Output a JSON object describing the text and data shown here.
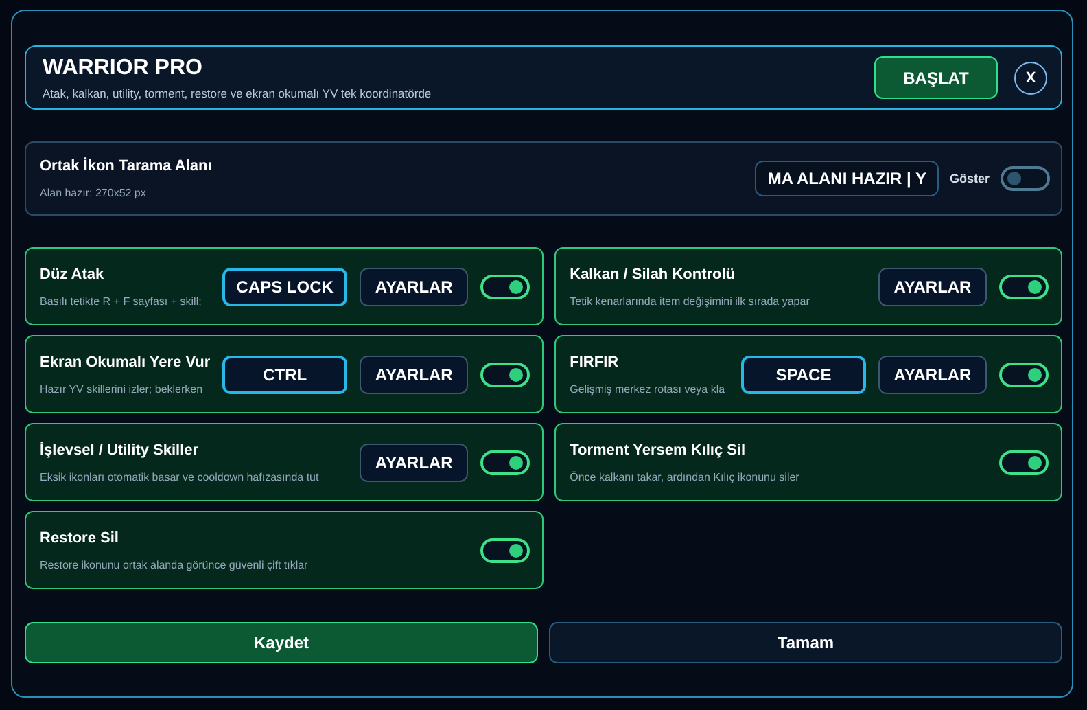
{
  "header": {
    "title": "WARRIOR PRO",
    "subtitle": "Atak, kalkan, utility, torment, restore ve ekran okumalı YV tek koordinatörde",
    "start_button": "BAŞLAT",
    "close_button": "X"
  },
  "scan_area": {
    "title": "Ortak İkon Tarama Alanı",
    "status": "Alan hazır: 270x52 px",
    "field_value": "MA ALANI HAZIR | Y",
    "show_label": "Göster",
    "show_on": false
  },
  "modules": [
    {
      "title": "Düz Atak",
      "description": "Basılı tetikte R + F sayfası + skill;",
      "key": "CAPS LOCK",
      "settings": "AYARLAR",
      "on": true
    },
    {
      "title": "Kalkan / Silah Kontrolü",
      "description": "Tetik kenarlarında item değişimini ilk sırada yapar",
      "settings": "AYARLAR",
      "on": true
    },
    {
      "title": "Ekran Okumalı Yere Vur",
      "description": "Hazır YV skillerini izler; beklerken",
      "key": "CTRL",
      "settings": "AYARLAR",
      "on": true
    },
    {
      "title": "FIRFIR",
      "description": "Gelişmiş merkez rotası veya kla",
      "key": "SPACE",
      "settings": "AYARLAR",
      "on": true
    },
    {
      "title": "İşlevsel / Utility Skiller",
      "description": "Eksik ikonları otomatik basar ve cooldown hafızasında tut",
      "settings": "AYARLAR",
      "on": true
    },
    {
      "title": "Torment Yersem Kılıç Sil",
      "description": "Önce kalkanı takar, ardından Kılıç ikonunu siler",
      "on": true
    },
    {
      "title": "Restore Sil",
      "description": "Restore ikonunu ortak alanda görünce güvenli çift tıklar",
      "on": true
    }
  ],
  "footer": {
    "save_button": "Kaydet",
    "ok_button": "Tamam"
  }
}
